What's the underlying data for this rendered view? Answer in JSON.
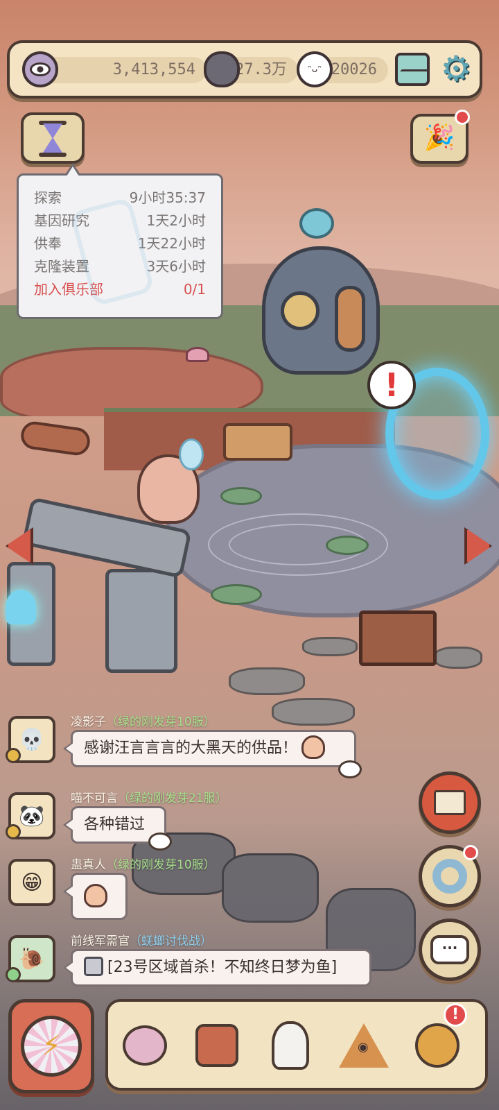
{
  "resources": {
    "eyes": "3,413,554",
    "stones": "27.3万",
    "souls": "20026"
  },
  "timers": {
    "rows": [
      {
        "label": "探索",
        "value": "9小时35:37"
      },
      {
        "label": "基因研究",
        "value": "1天2小时"
      },
      {
        "label": "供奉",
        "value": "1天22小时"
      },
      {
        "label": "克隆装置",
        "value": "3天6小时"
      }
    ],
    "club": {
      "label": "加入俱乐部",
      "value": "0/1"
    }
  },
  "chat": [
    {
      "name": "凌影子",
      "server": "（绿的刚发芽10服）",
      "message": "感谢汪言言言的大黑天的供品！"
    },
    {
      "name": "喵不可言",
      "server": "（绿的刚发芽21服）",
      "message": "各种错过"
    },
    {
      "name": "蛊真人",
      "server": "（绿的刚发芽10服）",
      "message": ""
    },
    {
      "name": "前线军需官",
      "server": "（蜣螂讨伐战）",
      "message": "[23号区域首杀！不知终日梦为鱼]"
    }
  ],
  "alerts": {
    "scene_alert": "!",
    "nav_badge": "!"
  },
  "icons": {
    "gear": "⚙",
    "party": "🎉",
    "compass": "⚡",
    "chat": "···"
  },
  "colors": {
    "panel_bg": "#f4e4c4",
    "outline": "#4b3a31",
    "alert_red": "#d94f4f",
    "server_green": "#a8e08c",
    "event_blue": "#8fd0ef"
  }
}
